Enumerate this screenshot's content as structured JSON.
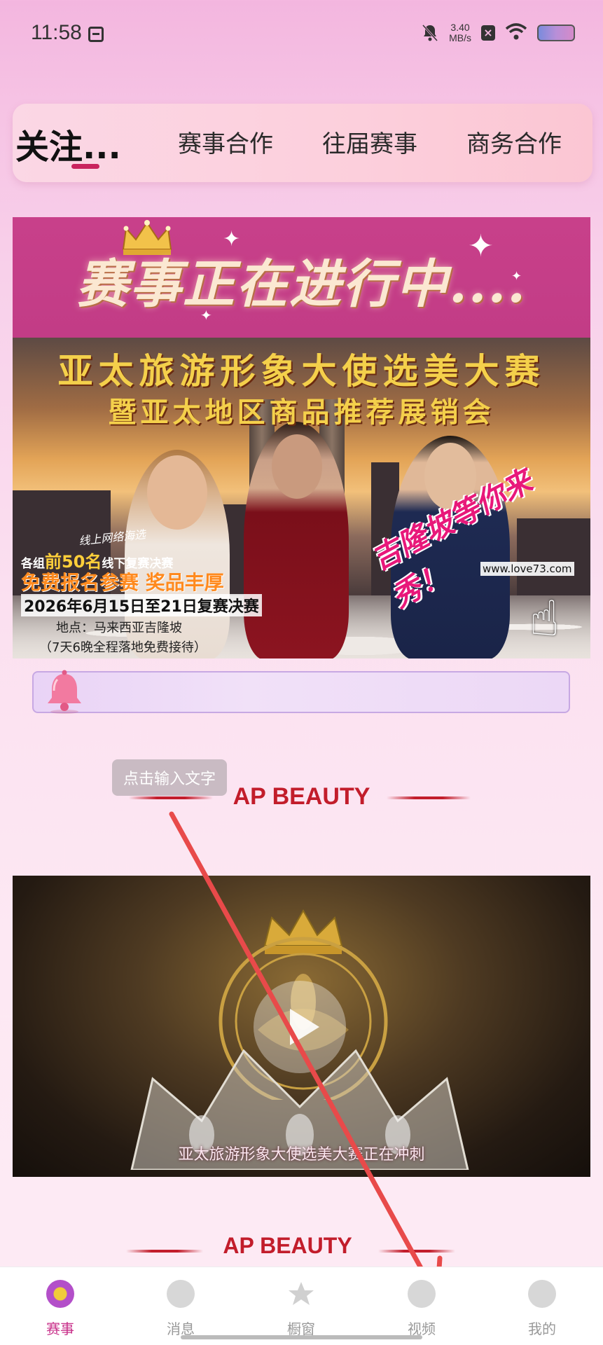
{
  "status_bar": {
    "time": "11:58",
    "net_speed_value": "3.40",
    "net_speed_unit": "MB/s"
  },
  "tabs": [
    {
      "label": "关注..."
    },
    {
      "label": "赛事合作"
    },
    {
      "label": "往届赛事"
    },
    {
      "label": "商务合作"
    }
  ],
  "banner": {
    "title": "赛事正在进行中....",
    "photo_title_1": "亚太旅游形象大使选美大赛",
    "photo_title_2": "暨亚太地区商品推荐展销会",
    "promo_small": "线上网络海选",
    "promo_groups_prefix": "各组",
    "promo_groups_highlight": "前50名",
    "promo_groups_suffix": "线下复赛决赛",
    "promo_free": "免费报名参赛  奖品丰厚",
    "promo_dates": "2026年6月15日至21日复赛决赛",
    "promo_location": "地点：马来西亚吉隆坡",
    "promo_hosting": "（7天6晚全程落地免费接待）",
    "promo_site": "www.love73.com",
    "promo_script": "吉隆坡等你来秀！"
  },
  "notice": {
    "text": ""
  },
  "tooltip": {
    "text": "点击输入文字"
  },
  "sections": {
    "heading_1": "AP BEAUTY",
    "heading_2": "AP BEAUTY"
  },
  "video": {
    "caption": "亚太旅游形象大使选美大赛正在冲刺"
  },
  "bottom_nav": [
    {
      "label": "赛事",
      "icon": "star-badge-icon",
      "active": true
    },
    {
      "label": "消息",
      "icon": "chat-bubble-icon",
      "active": false
    },
    {
      "label": "橱窗",
      "icon": "star-icon",
      "active": false
    },
    {
      "label": "视频",
      "icon": "film-reel-icon",
      "active": false
    },
    {
      "label": "我的",
      "icon": "smiley-face-icon",
      "active": false
    }
  ],
  "colors": {
    "accent": "#c8308a",
    "section_red": "#c21d2b",
    "annotation_arrow": "#e84a4a"
  }
}
